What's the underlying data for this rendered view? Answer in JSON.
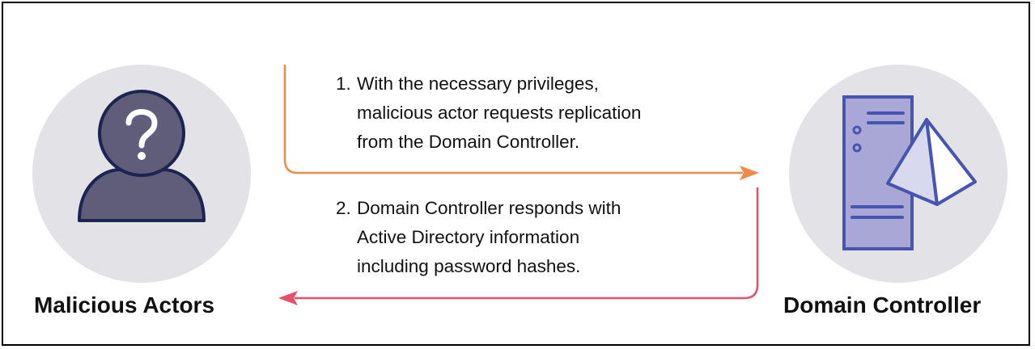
{
  "actors": {
    "left": {
      "label": "Malicious Actors",
      "icon": "unknown-person-icon"
    },
    "right": {
      "label": "Domain Controller",
      "icon": "server-icon"
    }
  },
  "steps": [
    {
      "number": "1.",
      "lines": [
        "With the necessary privileges,",
        "malicious actor requests replication",
        "from the Domain Controller."
      ],
      "direction": "to-right"
    },
    {
      "number": "2.",
      "lines": [
        "Domain Controller responds with",
        "Active Directory information",
        "including password hashes."
      ],
      "direction": "to-left"
    }
  ],
  "colors": {
    "circle": "#e3e2e7",
    "icon_fill": "#5f5d7a",
    "icon_outline": "#1c2450",
    "server_fill": "#a9a7d5",
    "server_stroke": "#4656b0",
    "pyramid_fill": "#d8d9ee",
    "arrow_request": "#f08a4b",
    "arrow_response": "#e5506b"
  }
}
